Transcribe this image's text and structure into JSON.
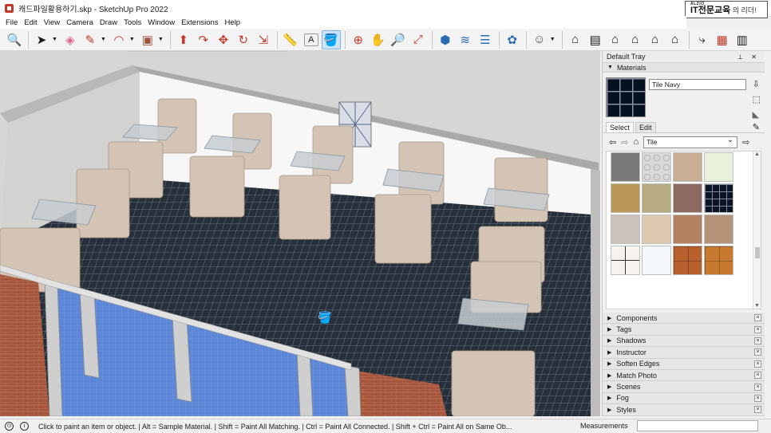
{
  "window": {
    "title": "캐드파일활용하기.skp - SketchUp Pro 2022"
  },
  "brand": {
    "small": "ALZIO",
    "main": "IT전문교육",
    "sub": "의 리더!"
  },
  "menu": [
    "File",
    "Edit",
    "View",
    "Camera",
    "Draw",
    "Tools",
    "Window",
    "Extensions",
    "Help"
  ],
  "toolbar": {
    "groups": [
      [
        "search-icon"
      ],
      [
        "select-icon",
        "eraser-icon",
        "pencil-icon",
        "arc-icon",
        "shape-icon"
      ],
      [
        "push-pull-icon",
        "follow-me-icon",
        "move-icon",
        "rotate-icon",
        "scale-icon"
      ],
      [
        "tape-measure-icon",
        "text-icon",
        "paint-bucket-icon"
      ],
      [
        "orbit-icon",
        "pan-icon",
        "zoom-icon",
        "zoom-extents-icon"
      ],
      [
        "solid-tools-icon",
        "sandbox-icon",
        "layers-icon",
        "styles-icon"
      ],
      [
        "account-icon"
      ],
      [
        "warehouse-icon",
        "book-icon",
        "house-icon",
        "house-front-icon",
        "house-outline-icon",
        "house-open-icon"
      ],
      [
        "extension-icon",
        "report-icon",
        "layout-icon"
      ]
    ],
    "active": "paint-bucket-icon",
    "glyphs": {
      "search": "🔍",
      "select": "➤",
      "eraser": "◈",
      "pencil": "✎",
      "arc": "◠",
      "shape": "▣",
      "push-pull": "⬆",
      "follow-me": "↷",
      "move": "✥",
      "rotate": "↻",
      "scale": "⇲",
      "tape": "📏",
      "text": "A",
      "paint": "🪣",
      "orbit": "⊕",
      "pan": "✋",
      "zoom": "🔎",
      "extents": "⤢",
      "solid": "⬢",
      "sandbox": "≋",
      "layers": "☰",
      "styles": "✿",
      "account": "☺",
      "warehouse": "⌂",
      "book": "▤",
      "house": "⌂",
      "house2": "⌂",
      "house3": "⌂",
      "house4": "⌂",
      "ext": "⤷",
      "report": "▦",
      "layout": "▥"
    }
  },
  "tray": {
    "title": "Default Tray",
    "materials_panel": {
      "heading": "Materials",
      "current_material": "Tile Navy",
      "tabs": [
        "Select",
        "Edit"
      ],
      "active_tab": "Select",
      "library": "Tile",
      "swatches": [
        {
          "name": "Tile Gray Smooth",
          "color": "#7a7a7a"
        },
        {
          "name": "Tile Hexagon",
          "color": "#d8d8d8"
        },
        {
          "name": "Tile Beige",
          "color": "#c9ad94"
        },
        {
          "name": "Tile Green Light",
          "color": "#e8f1dc"
        },
        {
          "name": "Tile Yellow Marble",
          "color": "#b99758"
        },
        {
          "name": "Tile Olive",
          "color": "#b7ab83"
        },
        {
          "name": "Tile Red Granite",
          "color": "#8c6a60"
        },
        {
          "name": "Tile Navy",
          "color": "#0a1424"
        },
        {
          "name": "Tile Stone Gray",
          "color": "#c9c3bc"
        },
        {
          "name": "Tile Sand",
          "color": "#dcc9b0"
        },
        {
          "name": "Tile Terracotta",
          "color": "#b28262"
        },
        {
          "name": "Tile Tan",
          "color": "#b49277"
        },
        {
          "name": "Tile Cross",
          "color": "#f6f3ef"
        },
        {
          "name": "Tile White",
          "color": "#f3f7fb"
        },
        {
          "name": "Tile Copper",
          "color": "#b8612f"
        },
        {
          "name": "Tile Orange Wood",
          "color": "#c7792f"
        }
      ]
    },
    "collapsed_panels": [
      "Components",
      "Tags",
      "Shadows",
      "Instructor",
      "Soften Edges",
      "Match Photo",
      "Scenes",
      "Fog",
      "Styles"
    ]
  },
  "status": {
    "hint": "Click to paint an item or object. | Alt = Sample Material. | Shift = Paint All Matching. | Ctrl = Paint All Connected. | Shift + Ctrl = Paint All on Same Ob...",
    "measurements_label": "Measurements",
    "measurements_value": ""
  },
  "colors": {
    "floor": "#2b313a",
    "wall": "#f5f5f5",
    "glass": "#5e86d8",
    "brick": "#a3553b",
    "furniture": "#d2c3b3"
  }
}
